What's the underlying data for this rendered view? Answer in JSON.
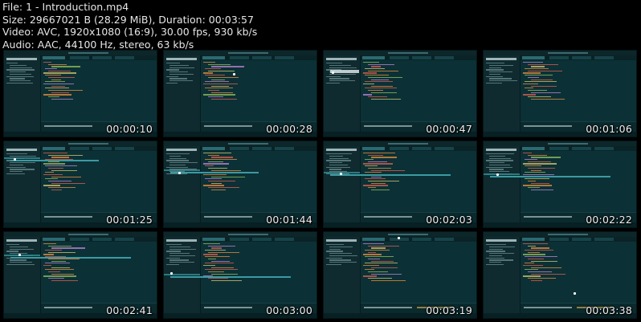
{
  "header": {
    "line1": "File: 1 - Introduction.mp4",
    "line2": "Size: 29667021 B (28.29 MiB), Duration: 00:03:57",
    "line3": "Video: AVC, 1920x1080 (16:9), 30.00 fps, 930 kb/s",
    "line4": "Audio: AAC, 44100 Hz, stereo, 63 kb/s"
  },
  "thumbnails": [
    {
      "timestamp": "00:00:10"
    },
    {
      "timestamp": "00:00:28"
    },
    {
      "timestamp": "00:00:47"
    },
    {
      "timestamp": "00:01:06"
    },
    {
      "timestamp": "00:01:25"
    },
    {
      "timestamp": "00:01:44"
    },
    {
      "timestamp": "00:02:03"
    },
    {
      "timestamp": "00:02:22"
    },
    {
      "timestamp": "00:02:41"
    },
    {
      "timestamp": "00:03:00"
    },
    {
      "timestamp": "00:03:19"
    },
    {
      "timestamp": "00:03:38"
    }
  ],
  "colors": {
    "background": "#000000",
    "editor_bg": "#0b3136",
    "code_red": "#d65b4f",
    "code_orange": "#e08a3c",
    "code_green": "#8fb85a",
    "accent_teal": "#2f8a92"
  }
}
